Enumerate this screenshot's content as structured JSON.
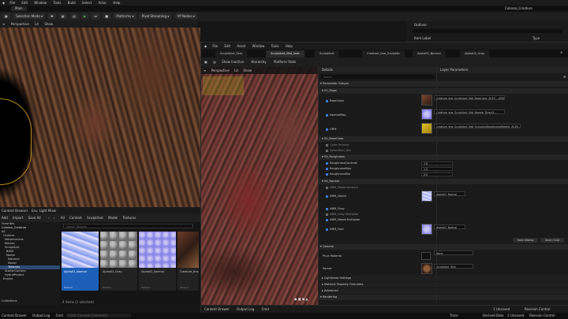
{
  "back": {
    "menu": [
      "File",
      "Edit",
      "Window",
      "Tools",
      "Build",
      "Select",
      "Actor",
      "Help"
    ],
    "tab": "Main",
    "project": "Colosso_Creature",
    "toolbar": {
      "selection_mode": "Selection Mode",
      "platforms": "Platforms",
      "pixel_streaming": "Pixel Streaming",
      "vp_nodes": "VP Nodes"
    },
    "viewport": {
      "perspective": "Perspective",
      "lit": "Lit",
      "show": "Show"
    },
    "outliner": {
      "title": "Outliner",
      "item_label": "Item Label",
      "type": "Type"
    },
    "content": {
      "tab": "Content Browser",
      "tab2": "Env. Light Mixer",
      "add": "Add",
      "import": "Import",
      "save_all": "Save All",
      "crumbs": [
        "All",
        "Content",
        "Sculpt4art",
        "Model",
        "Textures"
      ],
      "search_placeholder": "Search Textures",
      "folders_title": "Favorites",
      "project_title": "Colosso_Creature",
      "tree": [
        "All",
        "Content",
        "MetaHumans",
        "Movies",
        "Sculpt4art",
        "BASE",
        "Model",
        "Material",
        "Model",
        "Textures",
        "StarterContent",
        "HybridProject",
        "Engine"
      ],
      "assets": [
        {
          "name": "Alpha01_Normal",
          "type": "Texture"
        },
        {
          "name": "Alpha02_Gray",
          "type": "Texture"
        },
        {
          "name": "Alpha02_Normal",
          "type": "Texture"
        },
        {
          "name": "Creature_brw_Sculpt4art_Mat_BaseColor",
          "type": "Texture"
        }
      ],
      "collections": "Collections",
      "count": "4 items (1 selected)"
    },
    "status": {
      "drawer": "Content Drawer",
      "output": "Output Log",
      "cmd": "Cmd",
      "console_placeholder": "Enter Console Command",
      "trace": "Trace",
      "derived": "Derived Data",
      "unsaved": "3 Unsaved",
      "revision": "Revision Control"
    }
  },
  "mi": {
    "menu": [
      "File",
      "Edit",
      "Asset",
      "Window",
      "Tools",
      "Help"
    ],
    "tabs": [
      "Sculpt4art_Skin",
      "Sculpt4art_Mat_Instr",
      "Sculpt4art",
      "Creature_brw_Sculpt4a",
      "Alpha02_Normal",
      "Alpha02_Gray"
    ],
    "toolbar": {
      "save": "Save",
      "show_inactive": "Show Inactive",
      "hierarchy": "Hierarchy",
      "platform_stats": "Platform Stats"
    },
    "viewport": {
      "perspective": "Perspective",
      "lit": "Lit",
      "show": "Show"
    },
    "details_title": "Details",
    "params_title": "Layer Parameters",
    "search_placeholder": "Search",
    "groups": {
      "param_groups": "Parameter Groups",
      "maps": "01_Maps",
      "basecolor": "02_BaseColor",
      "roughness": "03_Roughness",
      "normal": "04_Normal",
      "general": "General",
      "lightmass": "Lightmass Settings",
      "mpo": "Material Property Overrides",
      "advanced": "Advanced",
      "rendering": "Rendering"
    },
    "params": {
      "basecolor": "BaseColor",
      "basecolor_val": "Creature_brw_Sculpt4art_Mat_BaseColor_ACES-...sRGB.png",
      "normalmap": "NormalMap",
      "normalmap_val": "Creature_brw_Sculpt4art_Mat_Normal_DirectX...",
      "orm": "ORM",
      "orm_val": "Creature_brw_Sculpt4art_Mat_OcclusionRoughnessMetallic_ACES...Main",
      "color_amount": "Color Amount",
      "saturation": "Saturation_Dm",
      "rough_contrast": "RoughnessContrast",
      "rough_contrast_val": "1.0",
      "rough_max": "RoughnessMax",
      "rough_max_val": "1.0",
      "rough_min": "RoughnessMin",
      "rough_min_val": "0.0",
      "normal_detail": "NRM_Detail Amount",
      "nrm_detail": "NRM_Detail",
      "nrm_detail_val": "Alpha01_Normal",
      "nrm_detail_mult": "NRM_Detail Multiplier",
      "nrm_gray": "NRM_Gray",
      "nrm_gray_mult": "NRM_Gray Multiplier",
      "nrm_fold": "NRM_Fold",
      "nrm_fold_val": "Alpha02_Normal",
      "save_sibling": "Save Sibling",
      "save_child": "Save Child",
      "phys_material": "Phys Material",
      "phys_val": "None",
      "parent": "Parent",
      "parent_val": "Sculpt4art_Skin"
    },
    "bottom": {
      "content_drawer": "Content Drawer",
      "output_log": "Output Log",
      "cmd": "Cmd",
      "unsaved": "1 Unsaved",
      "revision": "Revision Control"
    }
  }
}
